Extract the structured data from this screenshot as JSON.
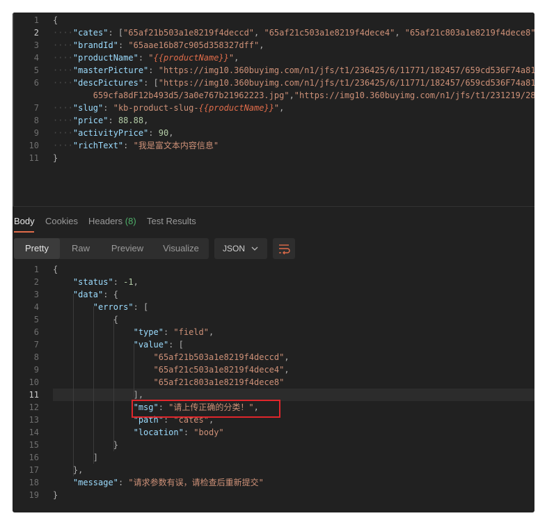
{
  "request": {
    "lines": [
      {
        "n": "1",
        "parts": [
          [
            "p",
            "{"
          ]
        ]
      },
      {
        "n": "2",
        "parts": [
          [
            "d",
            "····"
          ],
          [
            "k",
            "\"cates\""
          ],
          [
            "p",
            ": ["
          ],
          [
            "s",
            "\"65af21b503a1e8219f4deccd\""
          ],
          [
            "p",
            ", "
          ],
          [
            "s",
            "\"65af21c503a1e8219f4dece4\""
          ],
          [
            "p",
            ", "
          ],
          [
            "s",
            "\"65af21c803a1e8219f4dece8\""
          ]
        ]
      },
      {
        "n": "3",
        "parts": [
          [
            "d",
            "····"
          ],
          [
            "k",
            "\"brandId\""
          ],
          [
            "p",
            ": "
          ],
          [
            "s",
            "\"65aae16b87c905d358327dff\""
          ],
          [
            "p",
            ","
          ]
        ]
      },
      {
        "n": "4",
        "parts": [
          [
            "d",
            "····"
          ],
          [
            "k",
            "\"productName\""
          ],
          [
            "p",
            ": "
          ],
          [
            "s",
            "\""
          ],
          [
            "v",
            "{{productName}}"
          ],
          [
            "s",
            "\""
          ],
          [
            "p",
            ","
          ]
        ]
      },
      {
        "n": "5",
        "parts": [
          [
            "d",
            "····"
          ],
          [
            "k",
            "\"masterPicture\""
          ],
          [
            "p",
            ": "
          ],
          [
            "s",
            "\"https://img10.360buyimg.com/n1/jfs/t1/236425/6/11771/182457/659cd536F74a81"
          ]
        ]
      },
      {
        "n": "6",
        "parts": [
          [
            "d",
            "····"
          ],
          [
            "k",
            "\"descPictures\""
          ],
          [
            "p",
            ": ["
          ],
          [
            "s",
            "\"https://img10.360buyimg.com/n1/jfs/t1/236425/6/11771/182457/659cd536F74a81"
          ]
        ]
      },
      {
        "n": "",
        "parts": [
          [
            "s",
            "        659cfa8dF12b493d5/3a0e767b21962223.jpg\""
          ],
          [
            "p",
            ","
          ],
          [
            "s",
            "\"https://img10.360buyimg.com/n1/jfs/t1/231219/28"
          ]
        ]
      },
      {
        "n": "7",
        "parts": [
          [
            "d",
            "····"
          ],
          [
            "k",
            "\"slug\""
          ],
          [
            "p",
            ": "
          ],
          [
            "s",
            "\"kb-product-slug-"
          ],
          [
            "v",
            "{{productName}}"
          ],
          [
            "s",
            "\""
          ],
          [
            "p",
            ","
          ]
        ]
      },
      {
        "n": "8",
        "parts": [
          [
            "d",
            "····"
          ],
          [
            "k",
            "\"price\""
          ],
          [
            "p",
            ": "
          ],
          [
            "n",
            "88.88"
          ],
          [
            "p",
            ","
          ]
        ]
      },
      {
        "n": "9",
        "parts": [
          [
            "d",
            "····"
          ],
          [
            "k",
            "\"activityPrice\""
          ],
          [
            "p",
            ": "
          ],
          [
            "n",
            "90"
          ],
          [
            "p",
            ","
          ]
        ]
      },
      {
        "n": "10",
        "parts": [
          [
            "d",
            "····"
          ],
          [
            "k",
            "\"richText\""
          ],
          [
            "p",
            ": "
          ],
          [
            "s",
            "\"我是富文本内容信息\""
          ]
        ]
      },
      {
        "n": "11",
        "parts": [
          [
            "p",
            "}"
          ]
        ]
      }
    ]
  },
  "response_tabs": {
    "body": "Body",
    "cookies": "Cookies",
    "headers": "Headers",
    "headers_count": "(8)",
    "test_results": "Test Results"
  },
  "view_modes": {
    "pretty": "Pretty",
    "raw": "Raw",
    "preview": "Preview",
    "visualize": "Visualize",
    "format": "JSON"
  },
  "response": {
    "lines": [
      {
        "n": "1",
        "parts": [
          [
            "p",
            "{"
          ]
        ]
      },
      {
        "n": "2",
        "parts": [
          [
            "p",
            "    "
          ],
          [
            "k",
            "\"status\""
          ],
          [
            "p",
            ": "
          ],
          [
            "n",
            "-1"
          ],
          [
            "p",
            ","
          ]
        ]
      },
      {
        "n": "3",
        "parts": [
          [
            "p",
            "    "
          ],
          [
            "k",
            "\"data\""
          ],
          [
            "p",
            ": {"
          ]
        ]
      },
      {
        "n": "4",
        "parts": [
          [
            "p",
            "        "
          ],
          [
            "k",
            "\"errors\""
          ],
          [
            "p",
            ": ["
          ]
        ]
      },
      {
        "n": "5",
        "parts": [
          [
            "p",
            "            {"
          ]
        ]
      },
      {
        "n": "6",
        "parts": [
          [
            "p",
            "                "
          ],
          [
            "k",
            "\"type\""
          ],
          [
            "p",
            ": "
          ],
          [
            "s",
            "\"field\""
          ],
          [
            "p",
            ","
          ]
        ]
      },
      {
        "n": "7",
        "parts": [
          [
            "p",
            "                "
          ],
          [
            "k",
            "\"value\""
          ],
          [
            "p",
            ": ["
          ]
        ]
      },
      {
        "n": "8",
        "parts": [
          [
            "p",
            "                    "
          ],
          [
            "s",
            "\"65af21b503a1e8219f4deccd\""
          ],
          [
            "p",
            ","
          ]
        ]
      },
      {
        "n": "9",
        "parts": [
          [
            "p",
            "                    "
          ],
          [
            "s",
            "\"65af21c503a1e8219f4dece4\""
          ],
          [
            "p",
            ","
          ]
        ]
      },
      {
        "n": "10",
        "parts": [
          [
            "p",
            "                    "
          ],
          [
            "s",
            "\"65af21c803a1e8219f4dece8\""
          ]
        ]
      },
      {
        "n": "11",
        "parts": [
          [
            "p",
            "                ],"
          ]
        ]
      },
      {
        "n": "12",
        "parts": [
          [
            "p",
            "                "
          ],
          [
            "k",
            "\"msg\""
          ],
          [
            "p",
            ": "
          ],
          [
            "s",
            "\"请上传正确的分类！\""
          ],
          [
            "p",
            ","
          ]
        ]
      },
      {
        "n": "13",
        "parts": [
          [
            "p",
            "                "
          ],
          [
            "k",
            "\"path\""
          ],
          [
            "p",
            ": "
          ],
          [
            "s",
            "\"cates\""
          ],
          [
            "p",
            ","
          ]
        ]
      },
      {
        "n": "14",
        "parts": [
          [
            "p",
            "                "
          ],
          [
            "k",
            "\"location\""
          ],
          [
            "p",
            ": "
          ],
          [
            "s",
            "\"body\""
          ]
        ]
      },
      {
        "n": "15",
        "parts": [
          [
            "p",
            "            }"
          ]
        ]
      },
      {
        "n": "16",
        "parts": [
          [
            "p",
            "        ]"
          ]
        ]
      },
      {
        "n": "17",
        "parts": [
          [
            "p",
            "    },"
          ]
        ]
      },
      {
        "n": "18",
        "parts": [
          [
            "p",
            "    "
          ],
          [
            "k",
            "\"message\""
          ],
          [
            "p",
            ": "
          ],
          [
            "s",
            "\"请求参数有误，请检查后重新提交\""
          ]
        ]
      },
      {
        "n": "19",
        "parts": [
          [
            "p",
            "}"
          ]
        ]
      }
    ],
    "active_line": "11"
  },
  "colors": {
    "accent": "#e06c4a",
    "highlight_box": "#e0262b",
    "key": "#9cdcfe",
    "string": "#ce9178"
  }
}
